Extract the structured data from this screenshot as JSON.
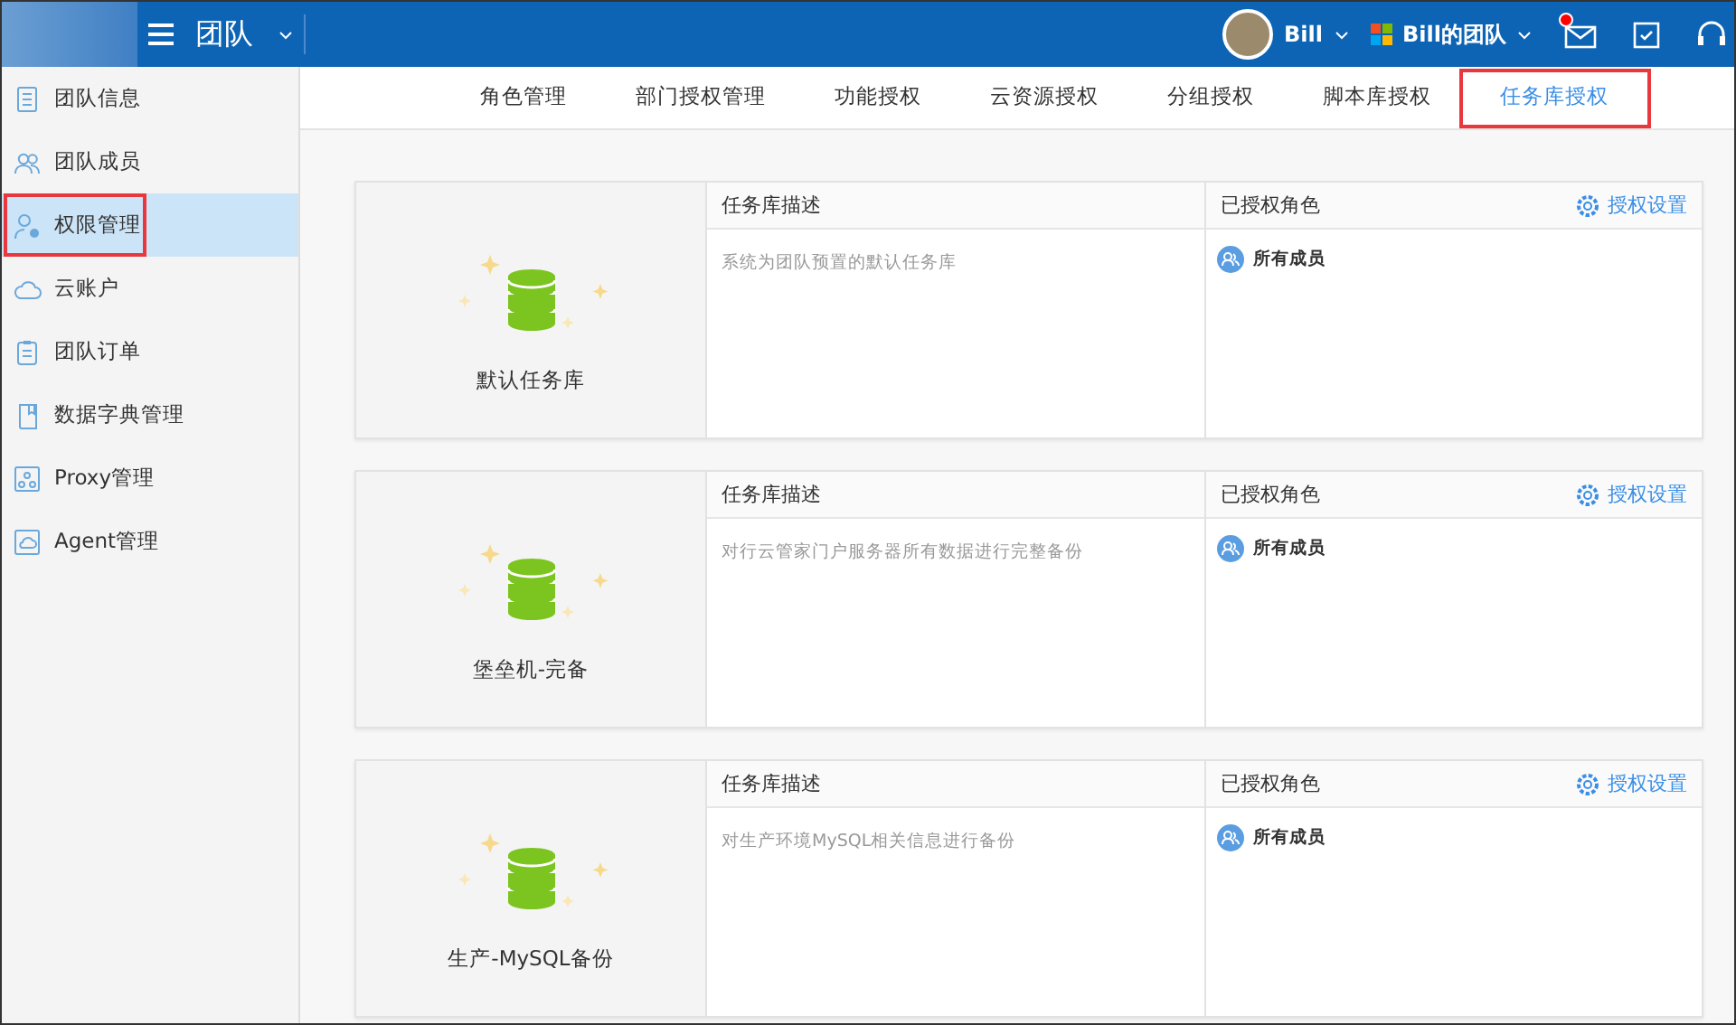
{
  "header": {
    "app_title": "团队",
    "user": {
      "name": "Bill"
    },
    "team": {
      "name": "Bill的团队"
    },
    "mail": {
      "unread": true
    }
  },
  "sidebar": {
    "items": [
      {
        "label": "团队信息",
        "kind": "doc",
        "selected": false,
        "highlighted": false
      },
      {
        "label": "团队成员",
        "kind": "people",
        "selected": false,
        "highlighted": false
      },
      {
        "label": "权限管理",
        "kind": "permissions",
        "selected": true,
        "highlighted": true
      },
      {
        "label": "云账户",
        "kind": "cloud",
        "selected": false,
        "highlighted": false
      },
      {
        "label": "团队订单",
        "kind": "clipboard",
        "selected": false,
        "highlighted": false
      },
      {
        "label": "数据字典管理",
        "kind": "book",
        "selected": false,
        "highlighted": false
      },
      {
        "label": "Proxy管理",
        "kind": "network",
        "selected": false,
        "highlighted": false
      },
      {
        "label": "Agent管理",
        "kind": "agent",
        "selected": false,
        "highlighted": false
      }
    ]
  },
  "tabs": [
    {
      "label": "角色管理",
      "selected": false,
      "highlighted": false
    },
    {
      "label": "部门授权管理",
      "selected": false,
      "highlighted": false
    },
    {
      "label": "功能授权",
      "selected": false,
      "highlighted": false
    },
    {
      "label": "云资源授权",
      "selected": false,
      "highlighted": false
    },
    {
      "label": "分组授权",
      "selected": false,
      "highlighted": false
    },
    {
      "label": "脚本库授权",
      "selected": false,
      "highlighted": false
    },
    {
      "label": "任务库授权",
      "selected": true,
      "highlighted": true
    }
  ],
  "libraries": [
    {
      "name": "默认任务库",
      "desc_header": "任务库描述",
      "description": "系统为团队预置的默认任务库",
      "roles_header": "已授权角色",
      "settings_link": "授权设置",
      "roles": [
        "所有成员"
      ]
    },
    {
      "name": "堡垒机-完备",
      "desc_header": "任务库描述",
      "description": "对行云管家门户服务器所有数据进行完整备份",
      "roles_header": "已授权角色",
      "settings_link": "授权设置",
      "roles": [
        "所有成员"
      ]
    },
    {
      "name": "生产-MySQL备份",
      "desc_header": "任务库描述",
      "description": "对生产环境MySQL相关信息进行备份",
      "roles_header": "已授权角色",
      "settings_link": "授权设置",
      "roles": [
        "所有成员"
      ]
    }
  ]
}
